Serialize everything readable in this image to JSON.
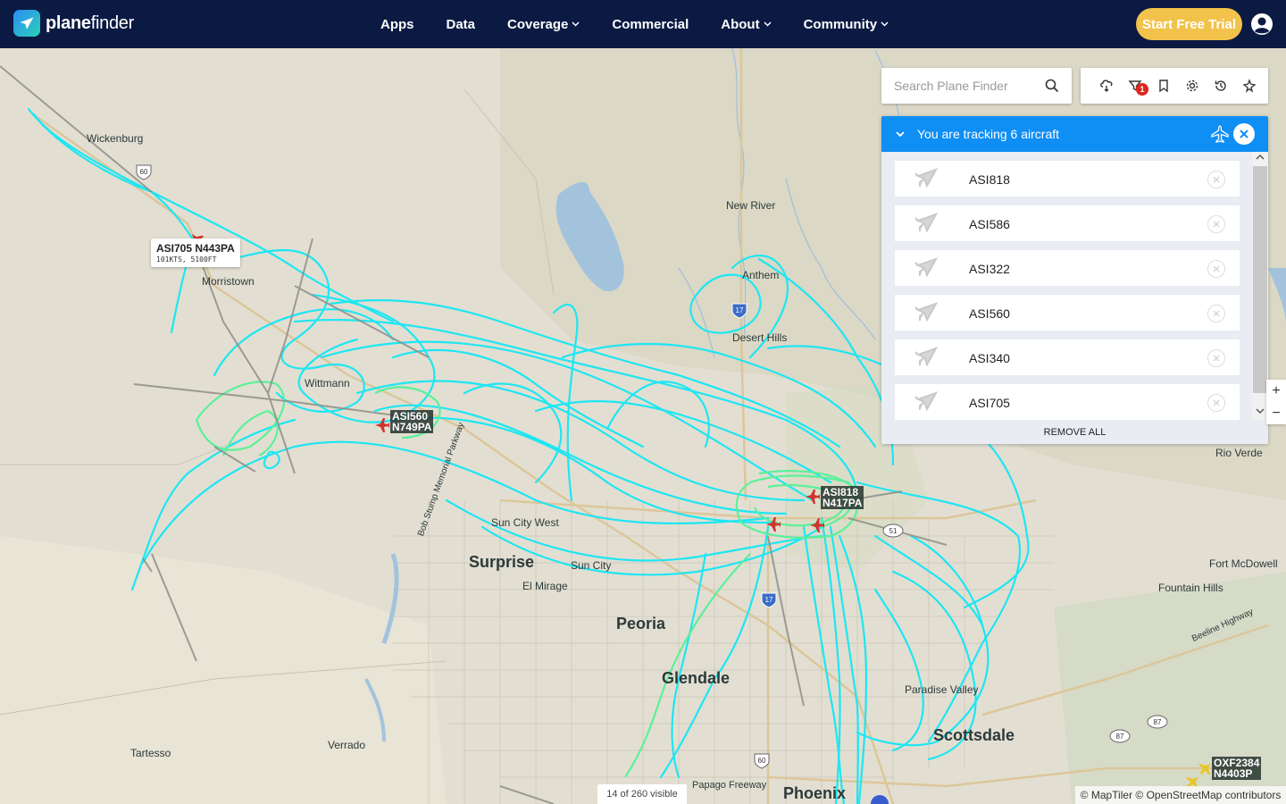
{
  "brand": {
    "name_bold": "plane",
    "name_thin": "finder"
  },
  "nav": {
    "items": [
      {
        "label": "Apps",
        "dropdown": false
      },
      {
        "label": "Data",
        "dropdown": false
      },
      {
        "label": "Coverage",
        "dropdown": true
      },
      {
        "label": "Commercial",
        "dropdown": false
      },
      {
        "label": "About",
        "dropdown": true
      },
      {
        "label": "Community",
        "dropdown": true
      }
    ],
    "cta_label": "Start Free Trial",
    "user_icon": "user-circle-icon"
  },
  "search": {
    "placeholder": "Search Plane Finder",
    "value": ""
  },
  "toolbar": {
    "icons": [
      "weather-icon",
      "filter-icon",
      "bookmark-icon",
      "settings-icon",
      "history-icon",
      "playback-icon"
    ],
    "filter_badge": "1"
  },
  "tracking": {
    "title": "You are tracking 6 aircraft",
    "aircraft": [
      "ASI818",
      "ASI586",
      "ASI322",
      "ASI560",
      "ASI340",
      "ASI705"
    ],
    "remove_all_label": "REMOVE ALL"
  },
  "zoom": {
    "in_label": "+",
    "out_label": "−"
  },
  "map": {
    "places": [
      {
        "name": "Wickenburg",
        "size": "small"
      },
      {
        "name": "Morristown",
        "size": "small"
      },
      {
        "name": "New River",
        "size": "small"
      },
      {
        "name": "Anthem",
        "size": "small"
      },
      {
        "name": "Desert Hills",
        "size": "small"
      },
      {
        "name": "Wittmann",
        "size": "small"
      },
      {
        "name": "Sun City West",
        "size": "small"
      },
      {
        "name": "Surprise",
        "size": "big"
      },
      {
        "name": "Sun City",
        "size": "small"
      },
      {
        "name": "El Mirage",
        "size": "small"
      },
      {
        "name": "Peoria",
        "size": "big"
      },
      {
        "name": "Glendale",
        "size": "big"
      },
      {
        "name": "Phoenix",
        "size": "big"
      },
      {
        "name": "Scottsdale",
        "size": "big"
      },
      {
        "name": "Paradise Valley",
        "size": "small"
      },
      {
        "name": "Fountain Hills",
        "size": "small"
      },
      {
        "name": "Fort McDowell",
        "size": "small"
      },
      {
        "name": "Rio Verde",
        "size": "small"
      },
      {
        "name": "Tartesso",
        "size": "small"
      },
      {
        "name": "Verrado",
        "size": "small"
      },
      {
        "name": "Bob Stump Memorial Parkway",
        "size": "small"
      },
      {
        "name": "Papago Freeway",
        "size": "small"
      },
      {
        "name": "Beeline Highway",
        "size": "small"
      }
    ],
    "shields": [
      "60",
      "60",
      "17",
      "17",
      "51",
      "87",
      "87",
      "60"
    ],
    "popup": {
      "title": "ASI705 N443PA",
      "subtitle": "101KTS, 5100FT"
    },
    "tags": [
      {
        "line1": "ASI560",
        "line2": "N749PA"
      },
      {
        "line1": "ASI818",
        "line2": "N417PA"
      },
      {
        "line1": "OXF2384",
        "line2": "N4403P"
      }
    ],
    "track_color": "#1ee6f2",
    "track_color_low": "#5cf09a"
  },
  "footer": {
    "visible_count": "14 of 260 visible",
    "attribution": "© MapTiler © OpenStreetMap contributors"
  }
}
